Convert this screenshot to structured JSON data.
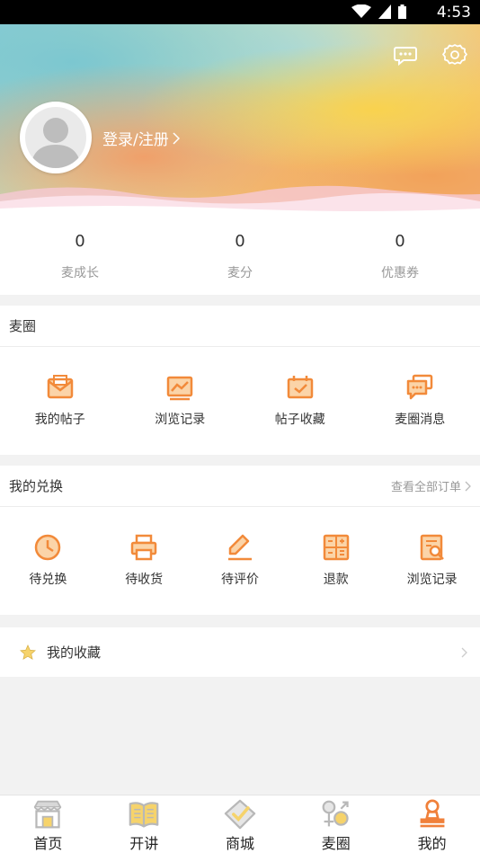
{
  "status_bar": {
    "time": "4:53"
  },
  "header": {
    "login_label": "登录/注册"
  },
  "stats": [
    {
      "value": "0",
      "label": "麦成长"
    },
    {
      "value": "0",
      "label": "麦分"
    },
    {
      "value": "0",
      "label": "优惠券"
    }
  ],
  "maiquan": {
    "title": "麦圈",
    "items": [
      {
        "label": "我的帖子",
        "icon": "post-icon"
      },
      {
        "label": "浏览记录",
        "icon": "browse-history-icon"
      },
      {
        "label": "帖子收藏",
        "icon": "post-favorite-icon"
      },
      {
        "label": "麦圈消息",
        "icon": "message-icon"
      }
    ]
  },
  "exchange": {
    "title": "我的兑换",
    "more_label": "查看全部订单",
    "items": [
      {
        "label": "待兑换",
        "icon": "clock-icon"
      },
      {
        "label": "待收货",
        "icon": "printer-icon"
      },
      {
        "label": "待评价",
        "icon": "pen-icon"
      },
      {
        "label": "退款",
        "icon": "calculator-icon"
      },
      {
        "label": "浏览记录",
        "icon": "search-doc-icon"
      }
    ]
  },
  "favorites": {
    "label": "我的收藏"
  },
  "tabbar": {
    "items": [
      {
        "label": "首页",
        "icon": "shop-icon"
      },
      {
        "label": "开讲",
        "icon": "book-icon"
      },
      {
        "label": "商城",
        "icon": "tag-icon"
      },
      {
        "label": "麦圈",
        "icon": "circle-people-icon"
      },
      {
        "label": "我的",
        "icon": "stamp-icon"
      }
    ],
    "active_index": 4
  },
  "colors": {
    "accent": "#f59a45",
    "active_tab": "#f0803a",
    "inactive_tab": "#b8b8b8"
  }
}
